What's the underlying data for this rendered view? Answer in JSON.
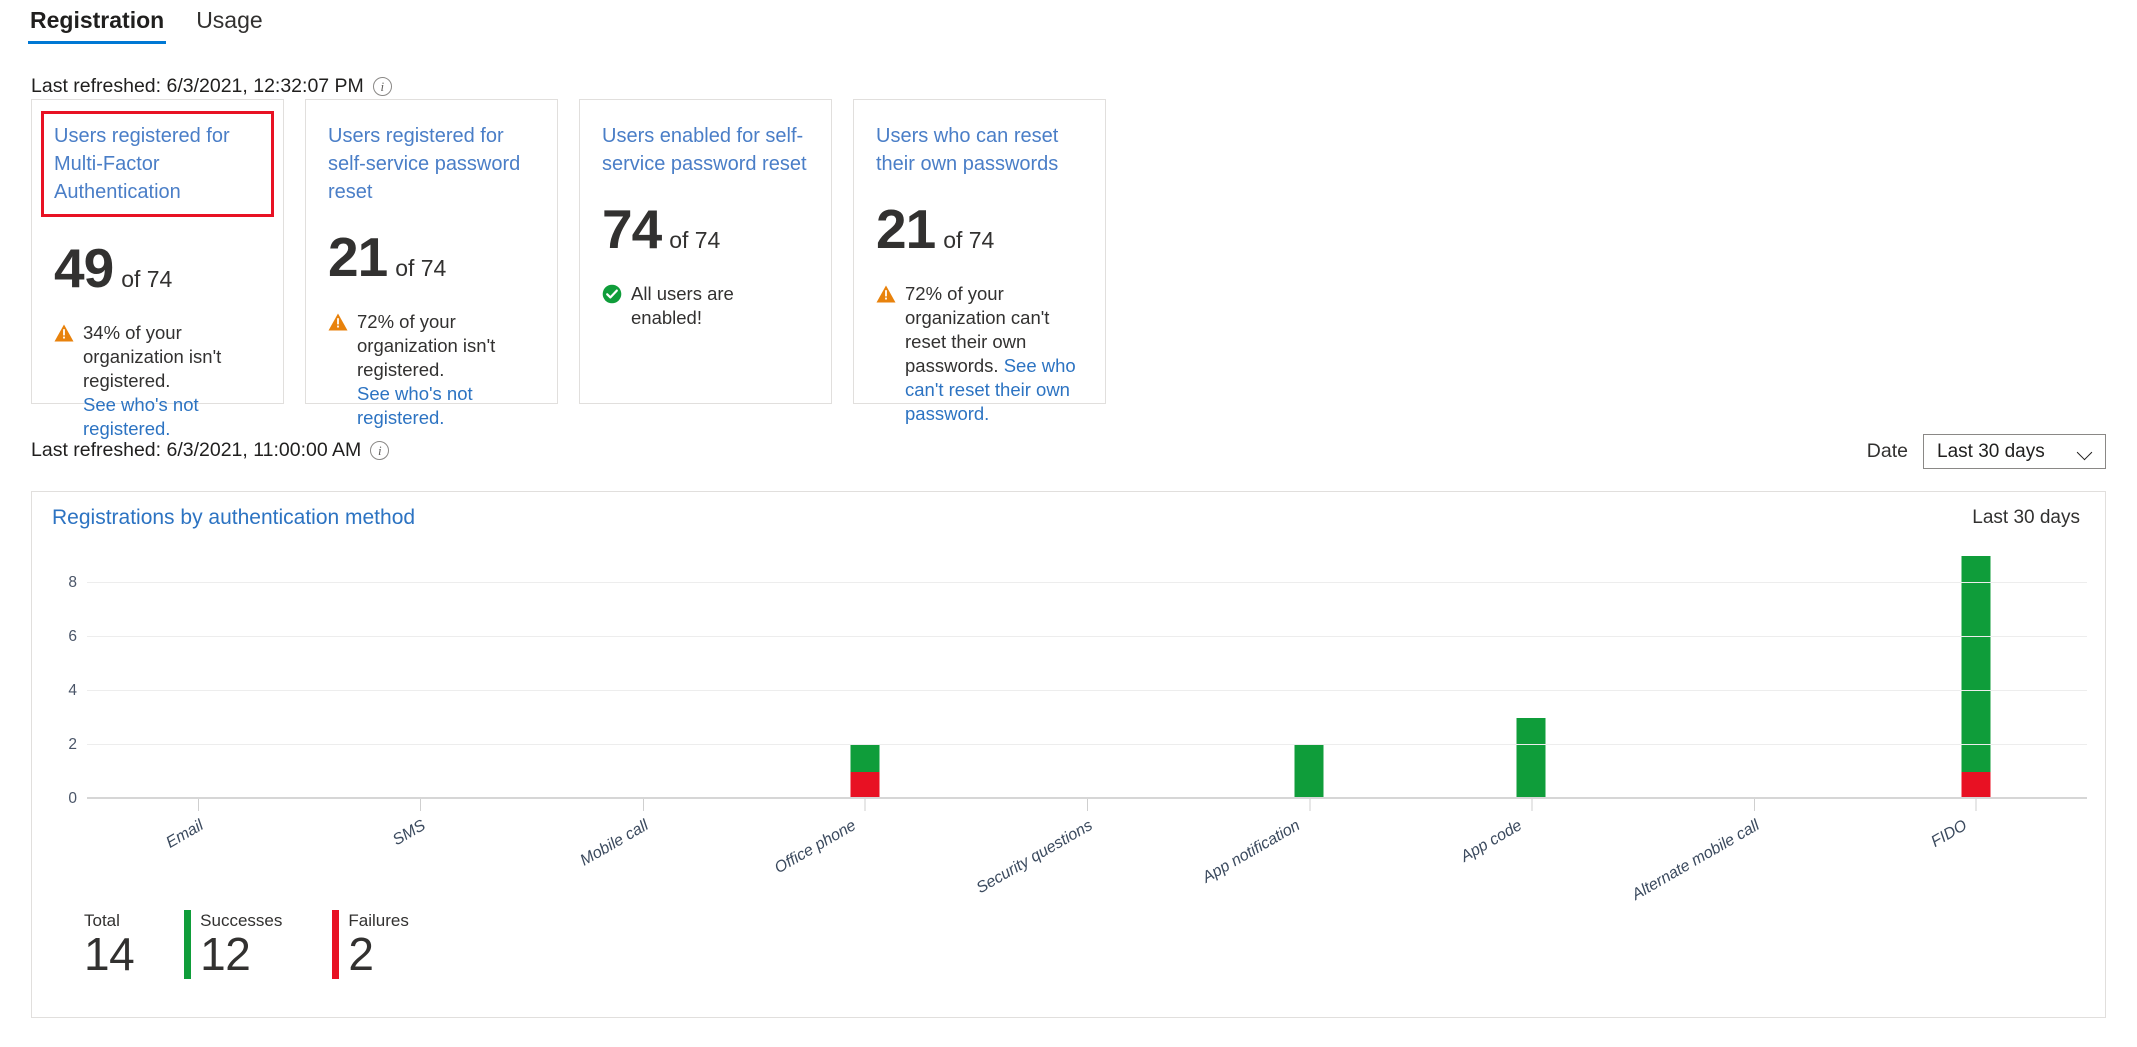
{
  "tabs": [
    {
      "label": "Registration",
      "active": true
    },
    {
      "label": "Usage",
      "active": false
    }
  ],
  "refresh_top": {
    "text": "Last refreshed: 6/3/2021, 12:32:07 PM",
    "info_icon": "info-icon"
  },
  "refresh_chart": {
    "text": "Last refreshed: 6/3/2021, 11:00:00 AM",
    "info_icon": "info-icon"
  },
  "cards": [
    {
      "title": "Users registered for Multi-Factor Authentication",
      "value": "49",
      "of": "of 74",
      "status": "warning",
      "status_icon": "warning-triangle-icon",
      "note": "34% of your organization isn't registered.",
      "link": "See who's not registered.",
      "highlighted": true
    },
    {
      "title": "Users registered for self-service password reset",
      "value": "21",
      "of": "of 74",
      "status": "warning",
      "status_icon": "warning-triangle-icon",
      "note": "72% of your organization isn't registered.",
      "link": "See who's not registered.",
      "highlighted": false
    },
    {
      "title": "Users enabled for self-service password reset",
      "value": "74",
      "of": "of 74",
      "status": "success",
      "status_icon": "check-circle-icon",
      "note": "All users are enabled!",
      "link": "",
      "highlighted": false
    },
    {
      "title": "Users who can reset their own passwords",
      "value": "21",
      "of": "of 74",
      "status": "warning",
      "status_icon": "warning-triangle-icon",
      "note": "72% of your organization can't reset their own passwords.",
      "link": "See who can't reset their own password.",
      "highlighted": false
    }
  ],
  "date_filter": {
    "label": "Date",
    "value": "Last 30 days",
    "chevron_icon": "chevron-down-icon"
  },
  "chart_panel": {
    "title": "Registrations by authentication method",
    "range_label": "Last 30 days"
  },
  "chart_data": {
    "type": "bar",
    "title": "Registrations by authentication method",
    "xlabel": "",
    "ylabel": "",
    "ylim": [
      0,
      9
    ],
    "yticks": [
      0,
      2,
      4,
      6,
      8
    ],
    "grid": true,
    "stacked": true,
    "legend_position": "bottom-left",
    "categories": [
      "Email",
      "SMS",
      "Mobile call",
      "Office phone",
      "Security questions",
      "App notification",
      "App code",
      "Alternate mobile call",
      "FIDO"
    ],
    "series": [
      {
        "name": "Successes",
        "color": "#0f9d3a",
        "values": [
          0,
          0,
          0,
          1,
          0,
          2,
          3,
          0,
          8
        ]
      },
      {
        "name": "Failures",
        "color": "#e81123",
        "values": [
          0,
          0,
          0,
          1,
          0,
          0,
          0,
          0,
          1
        ]
      }
    ]
  },
  "totals": [
    {
      "label": "Total",
      "value": "14",
      "color": ""
    },
    {
      "label": "Successes",
      "value": "12",
      "color": "#0f9d3a"
    },
    {
      "label": "Failures",
      "value": "2",
      "color": "#e81123"
    }
  ],
  "colors": {
    "accent": "#0078d4",
    "link": "#2c73c2",
    "success": "#0f9d3a",
    "failure": "#e81123",
    "warning": "#e8820c",
    "highlight_border": "#e81123"
  }
}
